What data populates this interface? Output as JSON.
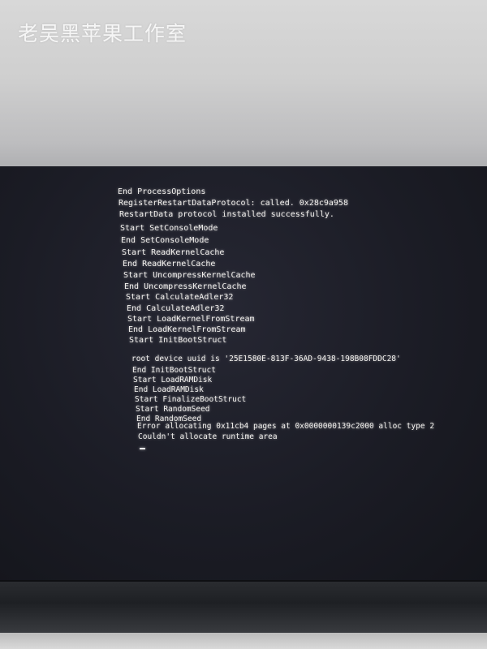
{
  "watermark": "老吴黑苹果工作室",
  "console": {
    "lines": [
      "End ProcessOptions",
      "RegisterRestartDataProtocol: called. 0x28c9a958",
      "RestartData protocol installed successfully.",
      "Start SetConsoleMode",
      "End SetConsoleMode",
      "Start ReadKernelCache",
      "End ReadKernelCache",
      "Start UncompressKernelCache",
      "End UncompressKernelCache",
      "Start CalculateAdler32",
      "End CalculateAdler32",
      "Start LoadKernelFromStream",
      "End LoadKernelFromStream",
      "Start InitBootStruct",
      "root device uuid is '25E1580E-813F-36AD-9438-198B08FDDC28'",
      "End InitBootStruct",
      "Start LoadRAMDisk",
      "End LoadRAMDisk",
      "Start FinalizeBootStruct",
      "Start RandomSeed",
      "End RandomSeed",
      "Error allocating 0x11cb4 pages at 0x0000000139c2000 alloc type 2",
      "Couldn't allocate runtime area"
    ],
    "cursor": "_"
  }
}
